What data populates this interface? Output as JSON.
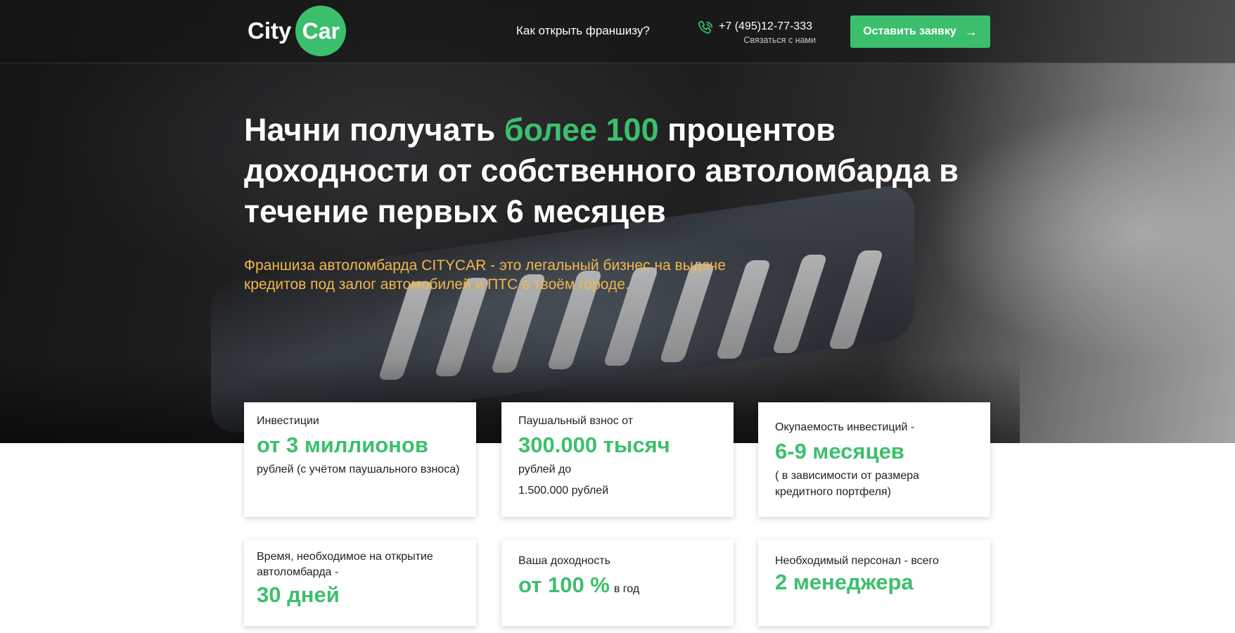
{
  "header": {
    "logo": {
      "city": "City",
      "car": "Car"
    },
    "nav_link": "Как открыть франшизу?",
    "phone": "+7 (495)12-77-333",
    "phone_sub": "Связаться с нами",
    "cta_label": "Оставить заявку",
    "cta_icon": "arrow-right-icon",
    "phone_icon": "phone-icon"
  },
  "hero": {
    "headline_part1": "Начни получать ",
    "headline_accent": "более 100",
    "headline_part2": " процентов доходности от собственного автоломбарда в течение первых 6 месяцев",
    "subline": "Франшиза автоломбарда CITYCAR - это легальный бизнес на выдаче кредитов под залог автомобилей  и ПТС в твоём городе."
  },
  "cards": {
    "investments": {
      "label": "Инвестиции",
      "value": "от 3 миллионов",
      "note": "рублей (с учётом паушального взноса)"
    },
    "fee": {
      "label": "Паушальный взнос от",
      "value": "300.000 тысяч",
      "note1": "рублей до",
      "note2": "1.500.000 рублей"
    },
    "payback": {
      "label": "Окупаемость инвестиций -",
      "value": "6-9 месяцев",
      "note": "( в зависимости от размера кредитного портфеля)"
    },
    "time": {
      "label": "Время, необходимое на открытие автоломбарда -",
      "value": "30 дней"
    },
    "profit": {
      "label": "Ваша доходность",
      "value": "от 100 %",
      "suffix": "в год"
    },
    "staff": {
      "label": "Необходимый персонал - всего",
      "value": "2 менеджера"
    }
  },
  "colors": {
    "accent": "#3cbf6c",
    "subline": "#f2b84b"
  }
}
